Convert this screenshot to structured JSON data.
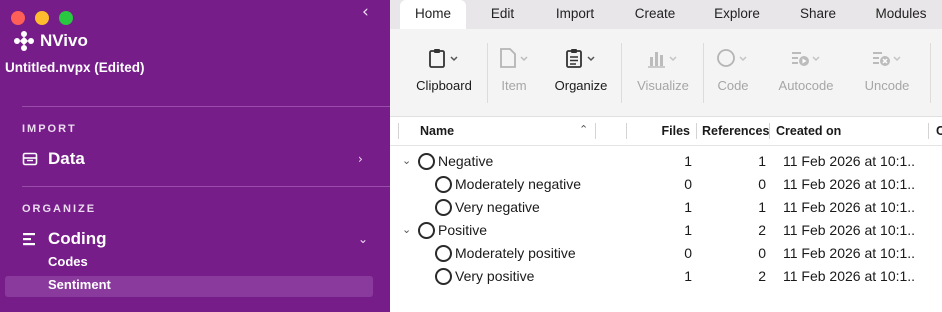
{
  "app": {
    "name": "NVivo",
    "file": "Untitled.nvpx (Edited)"
  },
  "sidebar": {
    "sections": [
      {
        "label": "IMPORT"
      },
      {
        "label": "ORGANIZE"
      }
    ],
    "nav": {
      "data": "Data",
      "coding": "Coding"
    },
    "sub_items": [
      "Codes",
      "Sentiment"
    ],
    "colors": {
      "bg": "#761d8a",
      "selected": "#8a3a9c"
    }
  },
  "tabs": [
    "Home",
    "Edit",
    "Import",
    "Create",
    "Explore",
    "Share",
    "Modules"
  ],
  "toolbar": {
    "items": [
      {
        "label": "Clipboard",
        "icon": "clipboard-icon",
        "enabled": true
      },
      {
        "label": "Item",
        "icon": "document-icon",
        "enabled": false
      },
      {
        "label": "Organize",
        "icon": "organize-icon",
        "enabled": true
      },
      {
        "label": "Visualize",
        "icon": "chart-icon",
        "enabled": false
      },
      {
        "label": "Code",
        "icon": "circle-icon",
        "enabled": false
      },
      {
        "label": "Autocode",
        "icon": "autocode-icon",
        "enabled": false
      },
      {
        "label": "Uncode",
        "icon": "uncode-icon",
        "enabled": false
      }
    ]
  },
  "table": {
    "headers": {
      "name": "Name",
      "files": "Files",
      "references": "References",
      "created_on": "Created on",
      "extra": "C"
    },
    "rows": [
      {
        "name": "Negative",
        "files": "1",
        "references": "1",
        "created_on": "11 Feb 2026 at 10:1...",
        "level": 0
      },
      {
        "name": "Moderately negative",
        "files": "0",
        "references": "0",
        "created_on": "11 Feb 2026 at 10:1...",
        "level": 1
      },
      {
        "name": "Very negative",
        "files": "1",
        "references": "1",
        "created_on": "11 Feb 2026 at 10:1...",
        "level": 1
      },
      {
        "name": "Positive",
        "files": "1",
        "references": "2",
        "created_on": "11 Feb 2026 at 10:1...",
        "level": 0
      },
      {
        "name": "Moderately positive",
        "files": "0",
        "references": "0",
        "created_on": "11 Feb 2026 at 10:1...",
        "level": 1
      },
      {
        "name": "Very positive",
        "files": "1",
        "references": "2",
        "created_on": "11 Feb 2026 at 10:1...",
        "level": 1
      }
    ]
  }
}
